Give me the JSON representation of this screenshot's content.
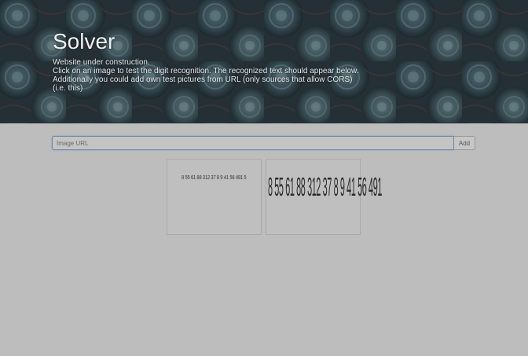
{
  "header": {
    "title": "Solver",
    "lines": [
      "Website under construction.",
      "Click on an image to test the digit recognition. The recognized text should appear below.",
      "Additionally you could add own test pictures from URL (only sources that allow CORS)",
      "(i.e. this)"
    ]
  },
  "url_form": {
    "placeholder": "Image URL",
    "value": "",
    "add_label": "Add"
  },
  "gallery": [
    {
      "digits": "8 55 61 88 312 37 8 9 41 56 491 5"
    },
    {
      "digits": "8 55 61 88 312 37 8 9 41 56 491"
    }
  ],
  "colors": {
    "background": "#bdbdbd",
    "hero_overlay": "#23323a",
    "input_border": "#6f8aa3"
  }
}
